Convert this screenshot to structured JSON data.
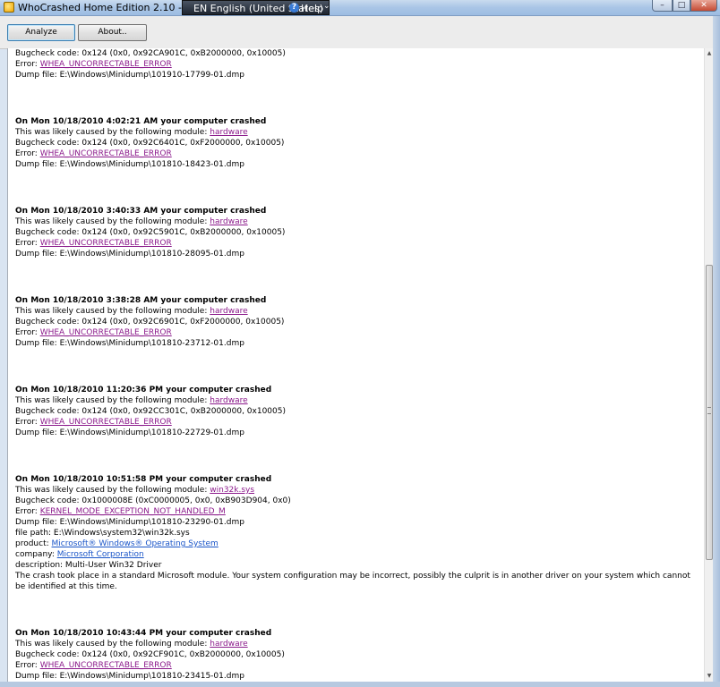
{
  "window": {
    "title": "WhoCrashed Home Edition 2.10 -  http://www.re",
    "minimize_glyph": "–",
    "maximize_glyph": "□",
    "close_glyph": "✕",
    "icon": "whocrashed-app-icon"
  },
  "language_bar": {
    "language": "EN English (United States)",
    "help_glyph": "?",
    "help": "Help",
    "arrow": "⌄"
  },
  "toolbar": {
    "analyze_label": "Analyze",
    "about_label": "About.."
  },
  "crashes": [
    {
      "title": "",
      "cause_prefix": "",
      "module": "",
      "bugcheck": "Bugcheck code: 0x124 (0x0, 0x92CA901C, 0xB2000000, 0x10005)",
      "error_prefix": "Error: ",
      "error": "WHEA_UNCORRECTABLE_ERROR",
      "dump": "Dump file: E:\\Windows\\Minidump\\101910-17799-01.dmp"
    },
    {
      "title": "On Mon 10/18/2010 4:02:21 AM your computer crashed",
      "cause_prefix": "This was likely caused by the following module: ",
      "module": "hardware",
      "bugcheck": "Bugcheck code: 0x124 (0x0, 0x92C6401C, 0xF2000000, 0x10005)",
      "error_prefix": "Error: ",
      "error": "WHEA_UNCORRECTABLE_ERROR",
      "dump": "Dump file: E:\\Windows\\Minidump\\101810-18423-01.dmp"
    },
    {
      "title": "On Mon 10/18/2010 3:40:33 AM your computer crashed",
      "cause_prefix": "This was likely caused by the following module: ",
      "module": "hardware",
      "bugcheck": "Bugcheck code: 0x124 (0x0, 0x92C5901C, 0xB2000000, 0x10005)",
      "error_prefix": "Error: ",
      "error": "WHEA_UNCORRECTABLE_ERROR",
      "dump": "Dump file: E:\\Windows\\Minidump\\101810-28095-01.dmp"
    },
    {
      "title": "On Mon 10/18/2010 3:38:28 AM your computer crashed",
      "cause_prefix": "This was likely caused by the following module: ",
      "module": "hardware",
      "bugcheck": "Bugcheck code: 0x124 (0x0, 0x92C6901C, 0xF2000000, 0x10005)",
      "error_prefix": "Error: ",
      "error": "WHEA_UNCORRECTABLE_ERROR",
      "dump": "Dump file: E:\\Windows\\Minidump\\101810-23712-01.dmp"
    },
    {
      "title": "On Mon 10/18/2010 11:20:36 PM your computer crashed",
      "cause_prefix": "This was likely caused by the following module: ",
      "module": "hardware",
      "bugcheck": "Bugcheck code: 0x124 (0x0, 0x92CC301C, 0xB2000000, 0x10005)",
      "error_prefix": "Error: ",
      "error": "WHEA_UNCORRECTABLE_ERROR",
      "dump": "Dump file: E:\\Windows\\Minidump\\101810-22729-01.dmp"
    },
    {
      "title": "On Mon 10/18/2010 10:51:58 PM your computer crashed",
      "cause_prefix": "This was likely caused by the following module: ",
      "module": "win32k.sys",
      "bugcheck": "Bugcheck code: 0x1000008E (0xC0000005, 0x0, 0xB903D904, 0x0)",
      "error_prefix": "Error: ",
      "error": "KERNEL_MODE_EXCEPTION_NOT_HANDLED_M",
      "dump": "Dump file: E:\\Windows\\Minidump\\101810-23290-01.dmp",
      "file_path": "file path: E:\\Windows\\system32\\win32k.sys",
      "product_prefix": "product: ",
      "product": "Microsoft® Windows® Operating System",
      "company_prefix": "company: ",
      "company": "Microsoft Corporation",
      "description": "description: Multi-User Win32 Driver",
      "note": "The crash took place in a standard Microsoft module. Your system configuration may be incorrect, possibly the culprit is in another driver on your system which cannot be identified at this time."
    },
    {
      "title": "On Mon 10/18/2010 10:43:44 PM your computer crashed",
      "cause_prefix": "This was likely caused by the following module: ",
      "module": "hardware",
      "bugcheck": "Bugcheck code: 0x124 (0x0, 0x92CF901C, 0xB2000000, 0x10005)",
      "error_prefix": "Error: ",
      "error": "WHEA_UNCORRECTABLE_ERROR",
      "dump": "Dump file: E:\\Windows\\Minidump\\101810-23415-01.dmp"
    }
  ],
  "scrollbar": {
    "up_glyph": "▲",
    "down_glyph": "▼"
  }
}
